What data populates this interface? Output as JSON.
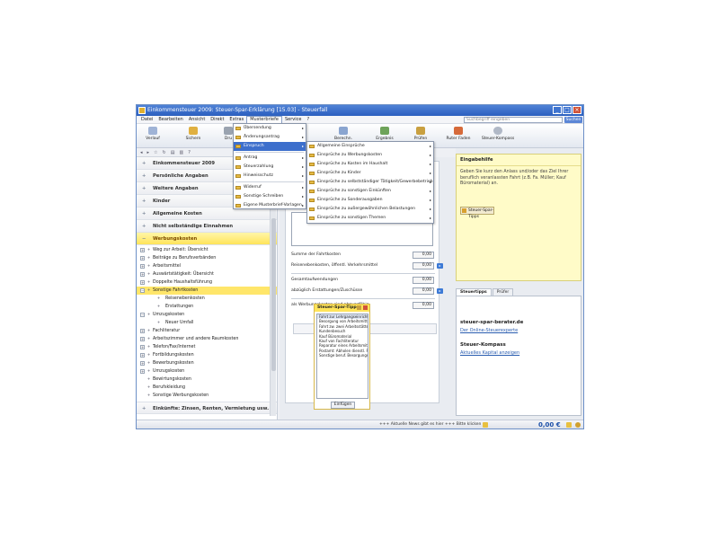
{
  "window": {
    "title": "Einkommensteuer 2009: Steuer-Spar-Erklärung [15.03] - Steuerfall"
  },
  "menu": [
    "Datei",
    "Bearbeiten",
    "Ansicht",
    "Direkt",
    "Extras",
    "Musterbriefe",
    "Service",
    "?"
  ],
  "search": {
    "placeholder": "Suchbegriff eingeben",
    "button": "Suchen"
  },
  "toolbar": {
    "back": "Verlauf",
    "save": "Sichern",
    "print": "Dru",
    "calc": "Berechn.",
    "result": "Ergebnis",
    "check": "Prüfen",
    "advisor": "Ruter Faden",
    "compass": "Steuer-Kompass"
  },
  "sidebar": {
    "categories": [
      "Einkommensteuer 2009",
      "Persönliche Angaben",
      "Weitere Angaben",
      "Kinder",
      "Allgemeine Kosten",
      "Nicht selbständige Einnahmen",
      "Werbungskosten"
    ],
    "tree": [
      {
        "label": "Weg zur Arbeit: Übersicht",
        "level": 1
      },
      {
        "label": "Beiträge zu Berufsverbänden",
        "level": 1
      },
      {
        "label": "Arbeitsmittel",
        "level": 1
      },
      {
        "label": "Auswärtstätigkeit: Übersicht",
        "level": 1
      },
      {
        "label": "Doppelte Haushaltsführung",
        "level": 1
      },
      {
        "label": "Sonstige Fahrtkosten",
        "level": 1
      },
      {
        "label": "Reisenebenkosten",
        "level": 2
      },
      {
        "label": "Erstattungen",
        "level": 2
      },
      {
        "label": "Umzugskosten",
        "level": 1
      },
      {
        "label": "Neuer Umfall",
        "level": 2
      },
      {
        "label": "Fachliteratur",
        "level": 1
      },
      {
        "label": "Arbeitszimmer und andere Raumkosten",
        "level": 1
      },
      {
        "label": "Telefon/Fax/Internet",
        "level": 1
      },
      {
        "label": "Fortbildungskosten",
        "level": 1
      },
      {
        "label": "Bewerbungskosten",
        "level": 1
      },
      {
        "label": "Umzugskosten",
        "level": 1
      },
      {
        "label": "Bewirtungskosten",
        "level": 1
      },
      {
        "label": "Berufskleidung",
        "level": 1
      },
      {
        "label": "Sonstige Werbungskosten",
        "level": 1
      }
    ],
    "bottom_category": "Einkünfte: Zinsen, Renten, Vermietung usw."
  },
  "form": {
    "rows": [
      {
        "label": "Summe der Fahrtkosten",
        "value": "0,00"
      },
      {
        "label": "Reisenebenkosten, öffentl. Verkehrsmittel",
        "value": "0,00"
      },
      {
        "label": "Gesamtaufwendungen",
        "value": "0,00"
      },
      {
        "label": "abzüglich Erstattungen/Zuschüsse",
        "value": "0,00"
      },
      {
        "label": "als Werbungskosten sind abzugsfähig",
        "value": "0,00"
      }
    ]
  },
  "musterbriefe_menu": [
    "Übersendung",
    "Änderungsantrag",
    "Einspruch",
    "Antrag",
    "Steuerzahlung",
    "Hinweisschutz",
    "Widerruf",
    "Sonstige Schreiben",
    "Eigene Musterbrief-Vorlagen"
  ],
  "einspruch_menu": [
    "Allgemeine Einsprüche",
    "Einsprüche zu Werbungskosten",
    "Einsprüche zu Kosten im Haushalt",
    "Einsprüche zu Kinder",
    "Einsprüche zu selbstständiger Tätigkeit/Gewerbebetrieb",
    "Einsprüche zu sonstigen Einkünften",
    "Einsprüche zu Sonderausgaben",
    "Einsprüche zu außergewöhnlichen Belastungen",
    "Einsprüche zu sonstigen Themen"
  ],
  "help": {
    "title": "Eingabehilfe",
    "text": "Geben Sie kurz den Anlass und/oder das Ziel Ihrer beruflich veranlassten Fahrt (z.B. Fa. Müller; Kauf Büromaterial) an.",
    "button": "Steuer-Spar-Tipps"
  },
  "tabs": [
    "Steuertipps",
    "Prüfer"
  ],
  "tabpanel": {
    "site": "steuer-spar-berater.de",
    "site_link": "Der Online-Steuerexperte",
    "compass": "Steuer-Kompass",
    "compass_link": "Aktuelles Kapital anzeigen"
  },
  "popup": {
    "title": "Steuer-Spar-Tipps",
    "items": [
      "Fahrt zur Lehrgangseinrichtung",
      "Besorgung von Arbeitsmitteln",
      "Fahrt zw. zwei Arbeitsstätten",
      "Kundenbesuch",
      "Kauf Büromaterial",
      "Kauf von Fachliteratur",
      "Reparatur eines Arbeitsmittels",
      "Postamt: Abholen dienstl. Post",
      "Sonstige beruf. Besorgungsfahrt"
    ],
    "insert": "Einfügen"
  },
  "status": {
    "ticker": "+++ Aktuelle News gibt es hier +++ Bitte klicken",
    "amount": "0,00 €"
  }
}
